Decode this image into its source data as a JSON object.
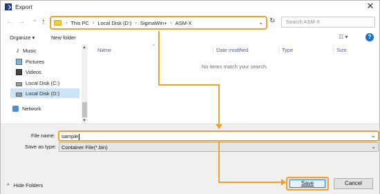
{
  "window": {
    "title": "Export",
    "close_glyph": "✕"
  },
  "nav": {
    "back_glyph": "←",
    "forward_glyph": "→",
    "recent_glyph": "⌄",
    "up_glyph": "↑",
    "breadcrumbs": [
      "This PC",
      "Local Disk (D:)",
      "SigmaWin+",
      "ASM-X"
    ],
    "separator": "›",
    "address_dropdown_glyph": "⌄",
    "refresh_glyph": "↻",
    "search_placeholder": "Search ASM-X"
  },
  "toolbar": {
    "organize_label": "Organize ▾",
    "new_folder_label": "New folder",
    "view_glyph": "☷ ▾",
    "help_glyph": "?"
  },
  "sidebar": {
    "items": [
      {
        "label": "Music",
        "icon": "music-icon"
      },
      {
        "label": "Pictures",
        "icon": "pictures-icon"
      },
      {
        "label": "Videos",
        "icon": "videos-icon"
      },
      {
        "label": "Local Disk (C:)",
        "icon": "drive-icon"
      },
      {
        "label": "Local Disk (D:)",
        "icon": "drive-icon"
      },
      {
        "label": "Network",
        "icon": "network-icon"
      }
    ],
    "scroll_up": "▲",
    "scroll_down": "▼"
  },
  "filelist": {
    "columns": [
      "Name",
      "Date modified",
      "Type",
      "Size"
    ],
    "sort_glyph": "^",
    "empty_message": "No items match your search."
  },
  "form": {
    "file_name_label": "File name:",
    "file_name_value": "sample",
    "save_as_label": "Save as type:",
    "save_as_value": "Container File(*.bin)",
    "dropdown_glyph": "⌄"
  },
  "footer": {
    "hide_folders_label": "Hide Folders",
    "hide_folders_glyph": "^",
    "save_label": "Save",
    "cancel_label": "Cancel"
  },
  "colors": {
    "highlight": "#f0a030",
    "selection": "#cce4f7",
    "accent": "#2f7fd0"
  }
}
